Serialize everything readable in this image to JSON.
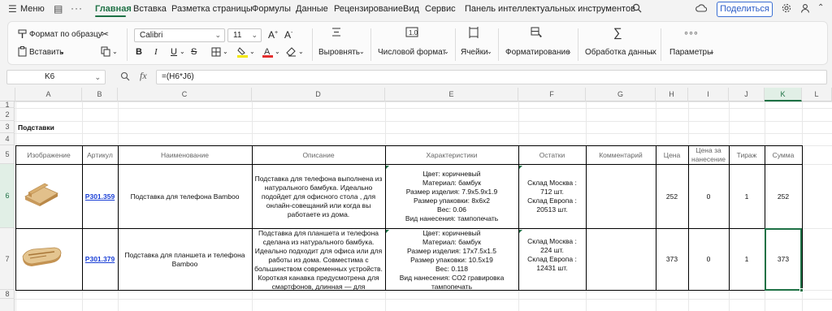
{
  "menubar": {
    "menu_label": "Меню",
    "tabs": [
      "Главная",
      "Вставка",
      "Разметка страницы",
      "Формулы",
      "Данные",
      "Рецензирование",
      "Вид",
      "Сервис",
      "Панель интеллектуальных инструментов"
    ],
    "share_label": "Поделиться",
    "accent_color": "#1e7145"
  },
  "ribbon": {
    "format_painter": "Формат по образцу",
    "paste": "Вставить",
    "font_name": "Calibri",
    "font_size": "11",
    "align": "Выровнять",
    "number_format": "Числовой формат",
    "cells": "Ячейки",
    "formatting": "Форматирование",
    "data_processing": "Обработка данных",
    "parameters": "Параметры"
  },
  "formula_bar": {
    "cell_ref": "K6",
    "fx": "fx",
    "formula": "=(H6*J6)"
  },
  "columns": [
    "A",
    "B",
    "C",
    "D",
    "E",
    "F",
    "G",
    "H",
    "I",
    "J",
    "K",
    "L"
  ],
  "rows": [
    "1",
    "2",
    "3",
    "4",
    "5",
    "6",
    "7",
    "8"
  ],
  "selected_cell": {
    "column": "K",
    "row": "6"
  },
  "sheet": {
    "title": "Подставки",
    "headers": {
      "image": "Изображение",
      "article": "Артикул",
      "name": "Наименование",
      "description": "Описание",
      "specs": "Характеристики",
      "stock": "Остатки",
      "comment": "Комментарий",
      "price": "Цена",
      "print_price": "Цена за нанесение",
      "run": "Тираж",
      "sum": "Сумма"
    },
    "items": [
      {
        "article": "P301.359",
        "name": "Подставка для телефона Bamboo",
        "description": "Подставка для телефона выполнена из натурального бамбука. Идеально подойдет для офисного стола , для онлайн-совещаний или когда вы работаете из дома.",
        "specs": [
          "Цвет: коричневый",
          "Материал: бамбук",
          "Размер изделия: 7.9x5.9x1.9",
          "Размер упаковки: 8x6x2",
          "Вес: 0.06",
          "Вид нанесения: тампопечать"
        ],
        "stock": [
          "Склад Москва : 712 шт.",
          "Склад Европа : 20513 шт."
        ],
        "comment": "",
        "price": "252",
        "print_price": "0",
        "run": "1",
        "sum": "252"
      },
      {
        "article": "P301.379",
        "name": "Подставка для планшета и телефона Bamboo",
        "description": "Подставка для планшета и телефона сделана из натурального бамбука. Идеально подходит для офиса или для работы из дома. Совместима с большинством современных устройств. Короткая канавка предусмотрена для смартфонов, длинная — для планшетов",
        "specs": [
          "Цвет: коричневый",
          "Материал: бамбук",
          "Размер изделия: 17x7.5x1.5",
          "Размер упаковки: 10.5x19",
          "Вес: 0.118",
          "Вид нанесения: CO2 гравировка тампопечать"
        ],
        "stock": [
          "Склад Москва : 224 шт.",
          "Склад Европа : 12431 шт."
        ],
        "comment": "",
        "price": "373",
        "print_price": "0",
        "run": "1",
        "sum": "373"
      }
    ]
  }
}
